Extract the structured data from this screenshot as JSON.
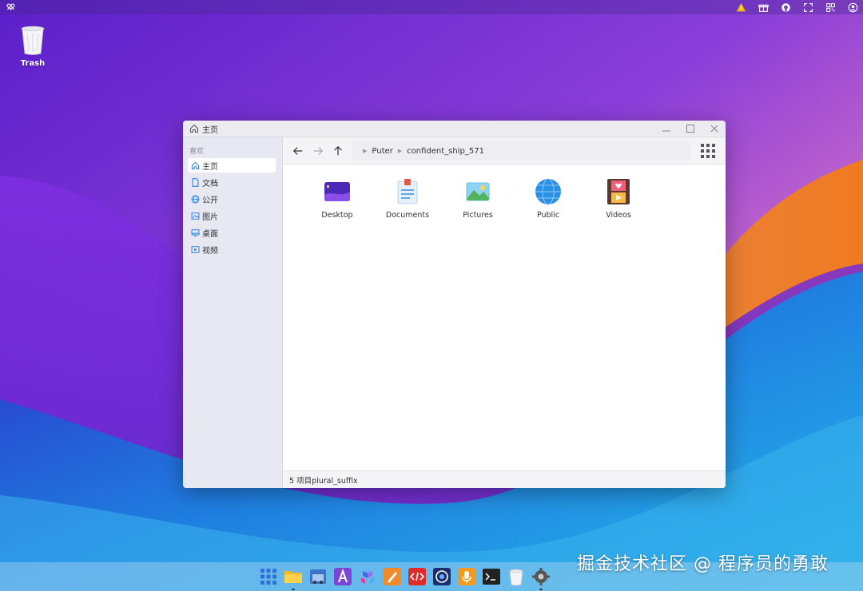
{
  "window": {
    "title": "主页",
    "sidebar": {
      "section_label": "喜欢",
      "items": [
        {
          "label": "主页",
          "icon": "home-icon",
          "active": true
        },
        {
          "label": "文档",
          "icon": "document-icon"
        },
        {
          "label": "公开",
          "icon": "globe-icon"
        },
        {
          "label": "图片",
          "icon": "image-icon"
        },
        {
          "label": "桌面",
          "icon": "monitor-icon"
        },
        {
          "label": "视频",
          "icon": "video-icon"
        }
      ]
    },
    "breadcrumb": [
      "Puter",
      "confident_ship_571"
    ],
    "items": [
      {
        "name": "Desktop",
        "icon": "desktop-folder-icon"
      },
      {
        "name": "Documents",
        "icon": "documents-folder-icon"
      },
      {
        "name": "Pictures",
        "icon": "pictures-folder-icon"
      },
      {
        "name": "Public",
        "icon": "public-folder-icon"
      },
      {
        "name": "Videos",
        "icon": "videos-folder-icon"
      }
    ],
    "status": "5 项目plural_suffix"
  },
  "desktop": {
    "trash_label": "Trash"
  },
  "watermark": "掘金技术社区 @ 程序员的勇敢",
  "colors": {
    "accent": "#2a7de1",
    "warning": "#f5b400"
  }
}
